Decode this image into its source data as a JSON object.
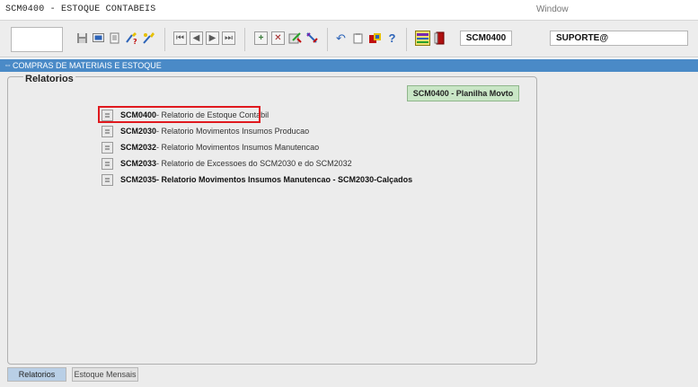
{
  "window": {
    "title": "SCM0400 - ESTOQUE CONTABEIS",
    "menu": "Window"
  },
  "toolbar": {
    "field_form": "SCM0400",
    "field_user": "SUPORTE@",
    "icons": [
      "save-icon",
      "screen-icon",
      "print-icon",
      "help-wizard-icon",
      "tools-icon",
      "first-record-icon",
      "prev-record-icon",
      "next-record-icon",
      "last-record-icon",
      "insert-record-icon",
      "delete-record-icon",
      "edit-record-icon",
      "zoom-record-icon",
      "undo-icon",
      "clipboard-icon",
      "settings-icon",
      "question-icon",
      "navigate-icon",
      "exit-icon"
    ],
    "glyphs": {
      "first": "⏮",
      "prev": "◀",
      "next": "▶",
      "last": "⏭",
      "insert": "+",
      "delete": "✕",
      "question": "?",
      "undo": "↶"
    }
  },
  "bluebar": {
    "label": "COMPRAS DE MATERIAIS E ESTOQUE"
  },
  "panel": {
    "title": "Relatorios",
    "planilha_label": "SCM0400 - Planilha Movto"
  },
  "reports": [
    {
      "code": "SCM0400",
      "desc": " - Relatorio de Estoque Contabil",
      "bold": false
    },
    {
      "code": "SCM2030",
      "desc": " - Relatorio Movimentos Insumos Producao",
      "bold": false
    },
    {
      "code": "SCM2032",
      "desc": " - Relatorio Movimentos Insumos Manutencao",
      "bold": false
    },
    {
      "code": "SCM2033",
      "desc": " - Relatorio de Excessoes do SCM2030 e do SCM2032",
      "bold": false
    },
    {
      "code": "SCM2035",
      "desc": " - Relatorio Movimentos Insumos Manutencao - SCM2030-Calçados",
      "bold": true
    }
  ],
  "tabs": [
    {
      "label": "Relatorios"
    },
    {
      "label": "Estoque Mensais"
    }
  ],
  "colors": {
    "accent": "#4a8ac7",
    "highlight": "#e0191e",
    "planilha": "#c9e6c6"
  }
}
